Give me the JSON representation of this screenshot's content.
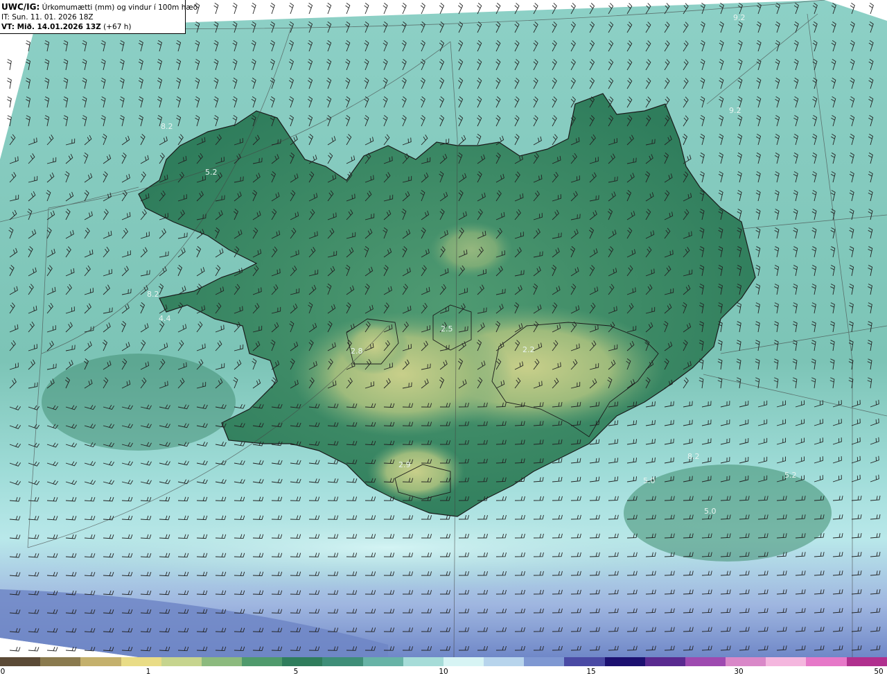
{
  "header": {
    "line1_bold": "UWC/IG:",
    "line1_rest": " Úrkomumætti (mm) og vindur í 100m hæð",
    "line2": "IT: Sun. 11. 01. 2026 18Z",
    "line3_bold": "VT: Mið. 14.01.2026 13Z",
    "line3_rest": " (+67 h)"
  },
  "map_labels": [
    "8.2",
    "5.2",
    "8.2",
    "4.4",
    "2.8",
    "2.5",
    "2.2",
    "2.9",
    "8.2",
    "5.0",
    "5.0",
    "9.2",
    "5.2",
    "9.2"
  ],
  "colorbar": {
    "ticks": [
      "0",
      "1",
      "5",
      "10",
      "15",
      "30",
      "50"
    ],
    "colors": [
      "#5b4a36",
      "#8a7a4e",
      "#c4b06c",
      "#e9dc86",
      "#c6d48e",
      "#8cba7e",
      "#4f9a6c",
      "#2f7d5c",
      "#3e8e78",
      "#67b3a6",
      "#a6dcd8",
      "#d7f4f4",
      "#b7d4ec",
      "#7f98d2",
      "#4a4aa4",
      "#1c1070",
      "#5a2a90",
      "#9e4ab0",
      "#d988c8",
      "#f4b6de",
      "#e678c8",
      "#b0308e"
    ]
  },
  "colors": {
    "ocean": "#7ec8c0",
    "ocean_light": "#a8e0dc",
    "land_dark": "#3d8a68",
    "land_mid": "#5aa07a",
    "highland": "#b0c27e",
    "south_blue": "#8098cc"
  }
}
